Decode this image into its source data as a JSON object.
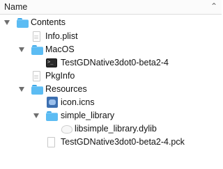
{
  "header": {
    "column_label": "Name",
    "sort_icon": "chevron-up-icon"
  },
  "tree": [
    {
      "label": "Contents",
      "icon": "folder-icon",
      "expanded": true
    },
    {
      "label": "Info.plist",
      "icon": "document-icon"
    },
    {
      "label": "MacOS",
      "icon": "folder-icon",
      "expanded": true
    },
    {
      "label": "TestGDNative3dot0-beta2-4",
      "icon": "executable-icon"
    },
    {
      "label": "PkgInfo",
      "icon": "document-icon"
    },
    {
      "label": "Resources",
      "icon": "folder-icon",
      "expanded": true
    },
    {
      "label": "icon.icns",
      "icon": "icns-icon"
    },
    {
      "label": "simple_library",
      "icon": "folder-icon",
      "expanded": true
    },
    {
      "label": "libsimple_library.dylib",
      "icon": "dylib-icon"
    },
    {
      "label": "TestGDNative3dot0-beta2-4.pck",
      "icon": "document-icon"
    }
  ]
}
